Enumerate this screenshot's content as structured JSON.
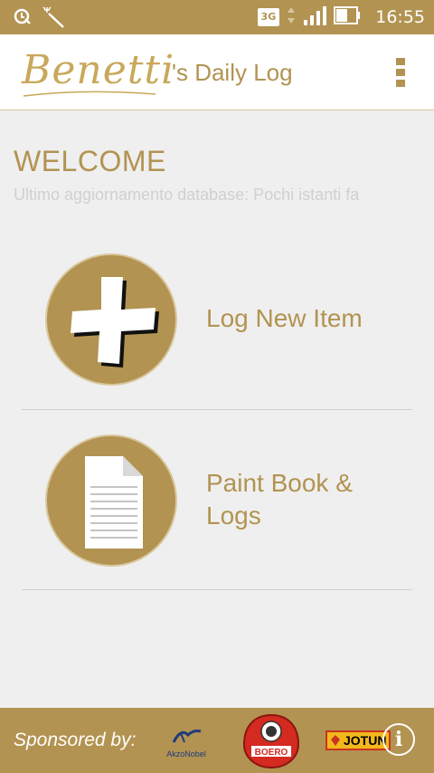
{
  "status_bar": {
    "network": "3G",
    "time": "16:55",
    "icons": [
      "data-saver-icon",
      "magic-wand-icon",
      "signal-icon",
      "battery-icon"
    ]
  },
  "app_bar": {
    "logo_text": "Benetti",
    "title": "'s Daily Log",
    "menu_icon": "overflow-menu-icon"
  },
  "main": {
    "welcome": "WELCOME",
    "last_update": "Ultimo aggiornamento database: Pochi istanti fa",
    "items": [
      {
        "label": "Log New Item",
        "icon": "plus-icon"
      },
      {
        "label": "Paint Book & Logs",
        "icon": "document-icon"
      }
    ]
  },
  "footer": {
    "sponsored_label": "Sponsored by:",
    "sponsors": [
      "AkzoNobel",
      "BOERO",
      "JOTUN"
    ],
    "info_icon": "info-icon"
  },
  "colors": {
    "accent": "#b29351",
    "background": "#efefef",
    "muted_text": "#d0d0d0"
  }
}
